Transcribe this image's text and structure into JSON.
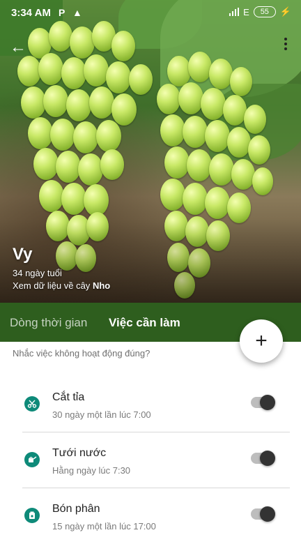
{
  "status_bar": {
    "time": "3:34 AM",
    "network": "E",
    "battery": "55"
  },
  "plant": {
    "name": "Vy",
    "age": "34 ngày tuổi",
    "info_prefix": "Xem dữ liệu về cây",
    "species": "Nho"
  },
  "tabs": [
    {
      "label": "Dòng thời gian",
      "active": false
    },
    {
      "label": "Việc cần làm",
      "active": true
    }
  ],
  "fab": {
    "label": "+"
  },
  "hint": "Nhắc việc không hoạt động đúng?",
  "tasks": [
    {
      "title": "Cắt tỉa",
      "schedule": "30 ngày một lần lúc 7:00",
      "icon": "scissors-icon",
      "enabled": true
    },
    {
      "title": "Tưới nước",
      "schedule": "Hằng ngày lúc 7:30",
      "icon": "watering-can-icon",
      "enabled": true
    },
    {
      "title": "Bón phân",
      "schedule": "15 ngày một lần lúc 17:00",
      "icon": "fertilizer-icon",
      "enabled": true
    }
  ],
  "colors": {
    "tab_bar": "#2e5e1e",
    "task_icon": "#0e8a79"
  }
}
